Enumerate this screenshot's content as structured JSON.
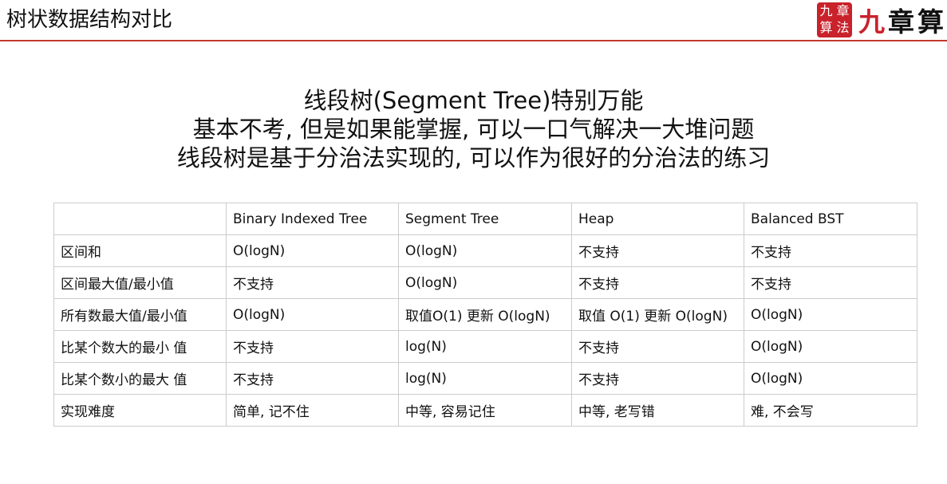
{
  "header": {
    "title": "树状数据结构对比",
    "logo_seal": [
      "九",
      "章",
      "算",
      "法"
    ],
    "logo_text_accent": "九",
    "logo_text_rest": "章算",
    "accent_color": "#c9222b"
  },
  "intro": {
    "lines": [
      "线段树(Segment Tree)特别万能",
      "基本不考, 但是如果能掌握, 可以一口气解决一大堆问题",
      "线段树是基于分治法实现的, 可以作为很好的分治法的练习"
    ]
  },
  "table": {
    "headers": [
      "",
      "Binary Indexed Tree",
      "Segment Tree",
      "Heap",
      "Balanced BST"
    ],
    "rows": [
      [
        "区间和",
        "O(logN)",
        "O(logN)",
        "不支持",
        "不支持"
      ],
      [
        "区间最大值/最小值",
        "不支持",
        "O(logN)",
        "不支持",
        "不支持"
      ],
      [
        "所有数最大值/最小值",
        "O(logN)",
        "取值O(1) 更新 O(logN)",
        "取值 O(1) 更新 O(logN)",
        "O(logN)"
      ],
      [
        "比某个数大的最小 值",
        "不支持",
        "log(N)",
        "不支持",
        "O(logN)"
      ],
      [
        "比某个数小的最大 值",
        "不支持",
        "log(N)",
        "不支持",
        "O(logN)"
      ],
      [
        "实现难度",
        "简单, 记不住",
        "中等, 容易记住",
        "中等, 老写错",
        "难, 不会写"
      ]
    ]
  }
}
